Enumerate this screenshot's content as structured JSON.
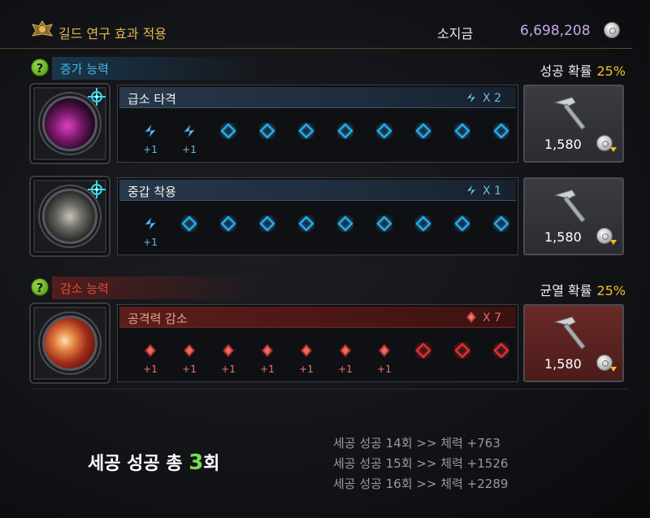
{
  "header": {
    "title": "길드 연구 효과 적용",
    "gold_label": "소지금",
    "gold_value": "6,698,208",
    "icons": {
      "emblem": "guild-emblem-icon",
      "coin": "silver-coin-icon"
    }
  },
  "colors": {
    "title_gold": "#e0b84e",
    "gold_value": "#c9a8e8",
    "increase_blue": "#47b8e8",
    "decrease_red": "#e04a3a",
    "percent_yellow": "#f0c020",
    "success_green": "#76e04a"
  },
  "increase_section": {
    "label": "증가 능력",
    "chance_label": "성공 확률",
    "chance_value": "25%",
    "rows": [
      {
        "name": "급소 타격",
        "multiplier": "X 2",
        "portrait": "magenta-orb",
        "slot_values": [
          "+1",
          "+1",
          "",
          "",
          "",
          "",
          "",
          "",
          "",
          ""
        ],
        "filled_slots": 2,
        "cost": "1,580"
      },
      {
        "name": "중갑 착용",
        "multiplier": "X 1",
        "portrait": "armored-figure-orb",
        "slot_values": [
          "+1",
          "",
          "",
          "",
          "",
          "",
          "",
          "",
          "",
          ""
        ],
        "filled_slots": 1,
        "cost": "1,580"
      }
    ]
  },
  "decrease_section": {
    "label": "감소 능력",
    "chance_label": "균열 확률",
    "chance_value": "25%",
    "rows": [
      {
        "name": "공격력 감소",
        "multiplier": "X 7",
        "portrait": "fire-orb",
        "slot_values": [
          "+1",
          "+1",
          "+1",
          "+1",
          "+1",
          "+1",
          "+1",
          "",
          "",
          ""
        ],
        "filled_slots": 7,
        "cost": "1,580"
      }
    ]
  },
  "summary": {
    "prefix": "세공 성공 총 ",
    "count": "3",
    "suffix": "회"
  },
  "log": [
    "세공 성공 14회 >> 체력 +763",
    "세공 성공 15회 >> 체력 +1526",
    "세공 성공 16회 >> 체력 +2289"
  ]
}
